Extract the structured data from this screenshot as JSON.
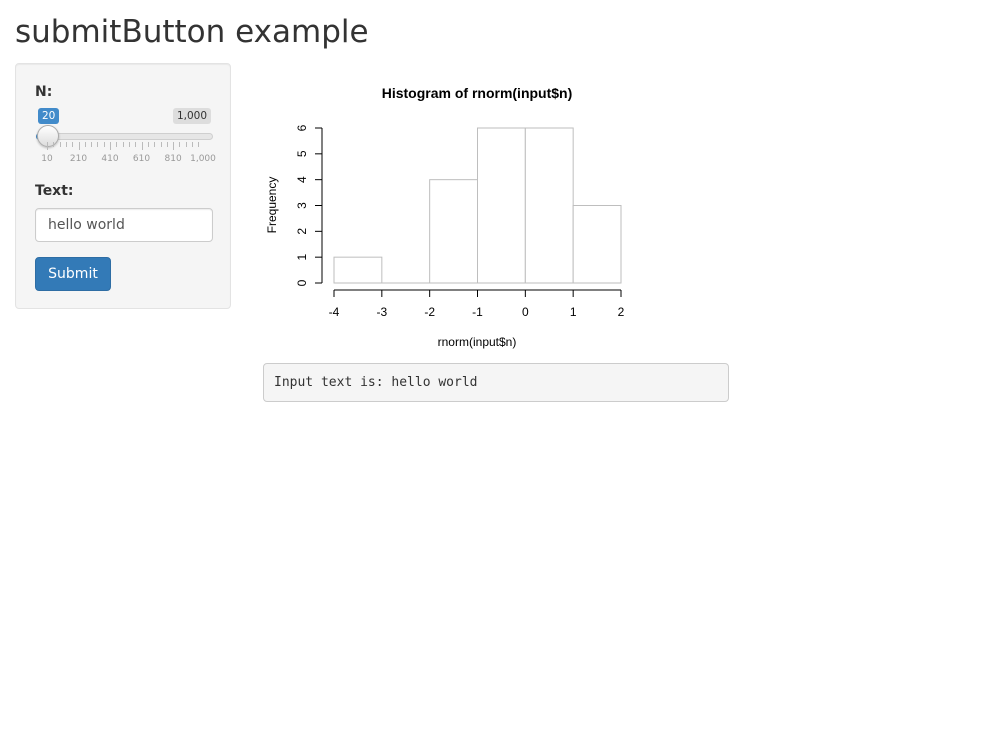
{
  "page": {
    "title": "submitButton example"
  },
  "sidebar": {
    "slider": {
      "label": "N:",
      "value": "20",
      "value_number": 20,
      "min": 10,
      "max": 1000,
      "max_label": "1,000",
      "ticks": [
        "10",
        "210",
        "410",
        "610",
        "810",
        "1,000"
      ],
      "accent_color": "#428bca"
    },
    "text_input": {
      "label": "Text:",
      "value": "hello world"
    },
    "submit_label": "Submit",
    "submit_color": "#337ab7"
  },
  "chart_data": {
    "type": "bar",
    "title": "Histogram of rnorm(input$n)",
    "xlabel": "rnorm(input$n)",
    "ylabel": "Frequency",
    "bins": [
      -4,
      -3,
      -2,
      -1,
      0,
      1,
      2
    ],
    "values": [
      1,
      0,
      4,
      6,
      6,
      3
    ],
    "xlim": [
      -4,
      2
    ],
    "ylim": [
      0,
      6
    ],
    "x_ticks": [
      "-4",
      "-3",
      "-2",
      "-1",
      "0",
      "1",
      "2"
    ],
    "y_ticks": [
      "0",
      "1",
      "2",
      "3",
      "4",
      "5",
      "6"
    ],
    "grid": false,
    "bar_fill": "#ffffff",
    "bar_stroke": "#bebebe"
  },
  "output": {
    "text": "Input text is: hello world"
  }
}
